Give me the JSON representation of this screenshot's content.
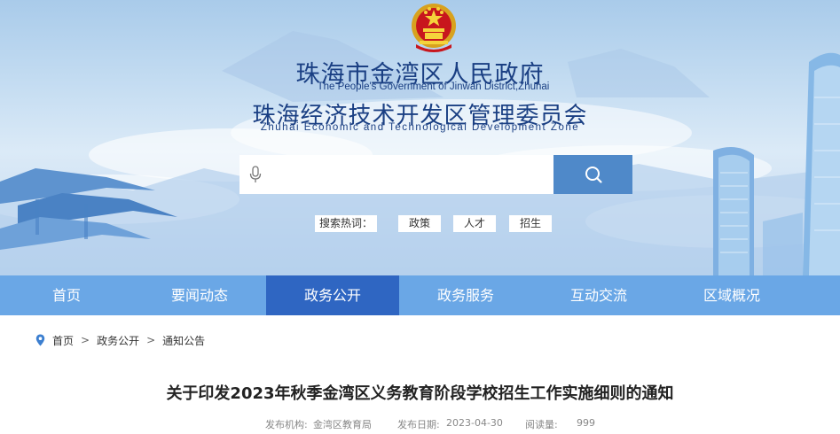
{
  "header": {
    "title_cn": "珠海市金湾区人民政府",
    "title_en": "The People's Government of Jinwan District,Zhuhai",
    "subtitle_cn": "珠海经济技术开发区管理委员会",
    "subtitle_en": "Zhuhai Economic and Technological Development Zone",
    "emblem_icon": "national-emblem-icon"
  },
  "search": {
    "placeholder": "",
    "mic_icon": "microphone-icon",
    "button_icon": "search-icon",
    "hot_label": "搜索热词：",
    "hot_words": [
      "政策",
      "人才",
      "招生"
    ]
  },
  "nav": {
    "items": [
      "首页",
      "要闻动态",
      "政务公开",
      "政务服务",
      "互动交流",
      "区域概况"
    ],
    "active": "政务公开"
  },
  "breadcrumb": {
    "icon": "location-pin-icon",
    "items": [
      "首页",
      "政务公开",
      "通知公告"
    ],
    "separator": ">"
  },
  "article": {
    "title": "关于印发2023年秋季金湾区义务教育阶段学校招生工作实施细则的通知",
    "publisher_label": "发布机构:",
    "publisher": "金湾区教育局",
    "date_label": "发布日期:",
    "date": "2023-04-30",
    "views_label": "阅读量:",
    "views": "999"
  },
  "colors": {
    "nav_bg": "#6aa7e6",
    "nav_active": "#2f66c2",
    "title_blue": "#1a3f83",
    "search_button": "#4f89c9"
  }
}
